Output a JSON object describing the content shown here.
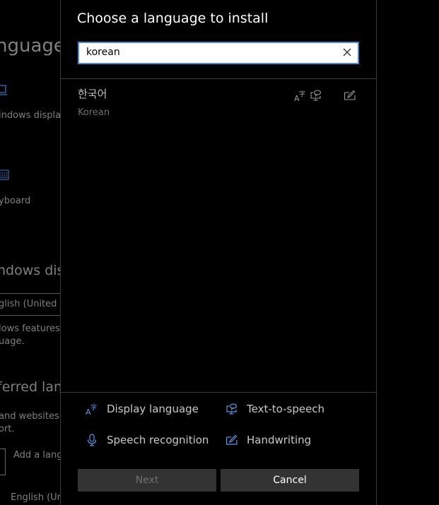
{
  "background": {
    "page_title_fragment": "nguage",
    "windows_display_fragment": "indows display",
    "keyboard_fragment": "yboard",
    "windows_display_heading_fragment": "ndows disp",
    "display_language_value_fragment": "glish (United K",
    "windows_features_fragment_1": "lows features,",
    "windows_features_fragment_2": "uage.",
    "preferred_heading_fragment": "ferred lang",
    "websites_fragment_1": " and websites",
    "websites_fragment_2": "ort.",
    "add_language_fragment": "Add a lang",
    "english_fragment": "English (Un"
  },
  "dialog": {
    "title": "Choose a language to install",
    "search": {
      "value": "korean",
      "placeholder": ""
    },
    "results": [
      {
        "native_name": "한국어",
        "english_name": "Korean",
        "features": [
          "display-language",
          "text-to-speech",
          "handwriting"
        ]
      }
    ],
    "legend": [
      {
        "icon": "display-language-icon",
        "label": "Display language"
      },
      {
        "icon": "text-to-speech-icon",
        "label": "Text-to-speech"
      },
      {
        "icon": "speech-recognition-icon",
        "label": "Speech recognition"
      },
      {
        "icon": "handwriting-icon",
        "label": "Handwriting"
      }
    ],
    "buttons": {
      "next": "Next",
      "cancel": "Cancel"
    }
  },
  "colors": {
    "accent": "#4f8ad0",
    "icon_blue": "#5b9ae0",
    "button_bg": "#333333"
  }
}
